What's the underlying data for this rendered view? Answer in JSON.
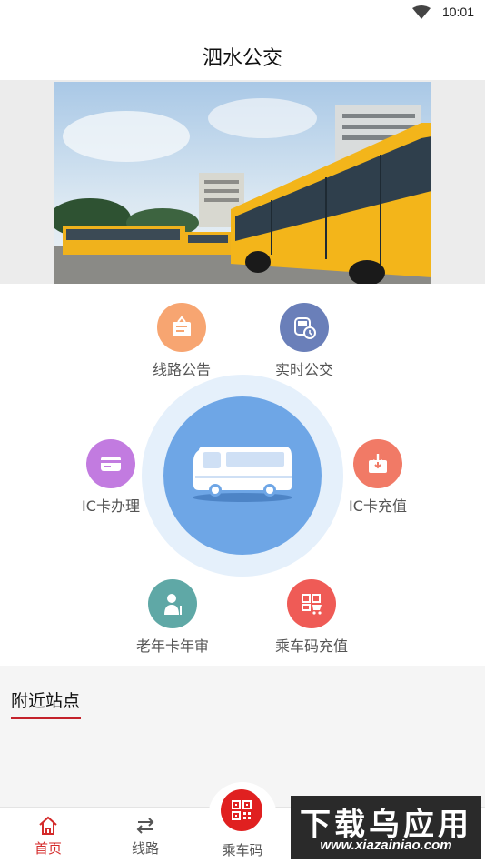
{
  "status_bar": {
    "time": "10:01",
    "wifi_icon": "wifi-icon"
  },
  "header": {
    "title": "泗水公交"
  },
  "banner": {
    "image": "yellow-city-buses-photo"
  },
  "functions": {
    "line_announcement": {
      "label": "线路公告",
      "icon": "notice-board-icon",
      "color": "#f7a571"
    },
    "realtime_bus": {
      "label": "实时公交",
      "icon": "bus-clock-icon",
      "color": "#6a7fb9"
    },
    "ic_card_apply": {
      "label": "IC卡办理",
      "icon": "card-icon",
      "color": "#c27be0"
    },
    "ic_card_recharge": {
      "label": "IC卡充值",
      "icon": "download-box-icon",
      "color": "#f17a66"
    },
    "elder_card_review": {
      "label": "老年卡年审",
      "icon": "elder-person-icon",
      "color": "#5fa8a6"
    },
    "qr_recharge": {
      "label": "乘车码充值",
      "icon": "qr-cart-icon",
      "color": "#ef5b56"
    },
    "center": {
      "icon": "bus-icon",
      "color": "#6ea6e6"
    }
  },
  "nearby": {
    "title": "附近站点",
    "accent": "#c4222b"
  },
  "bottom_nav": {
    "items": [
      {
        "label": "首页",
        "icon": "home-icon",
        "active": true
      },
      {
        "label": "线路",
        "icon": "route-arrows-icon",
        "active": false
      },
      {
        "label": "乘车码",
        "icon": "qr-code-icon",
        "active": false
      }
    ],
    "active_color": "#d42a2a"
  },
  "watermark": {
    "main": "下载乌应用",
    "url": "www.xiazainiao.com"
  }
}
